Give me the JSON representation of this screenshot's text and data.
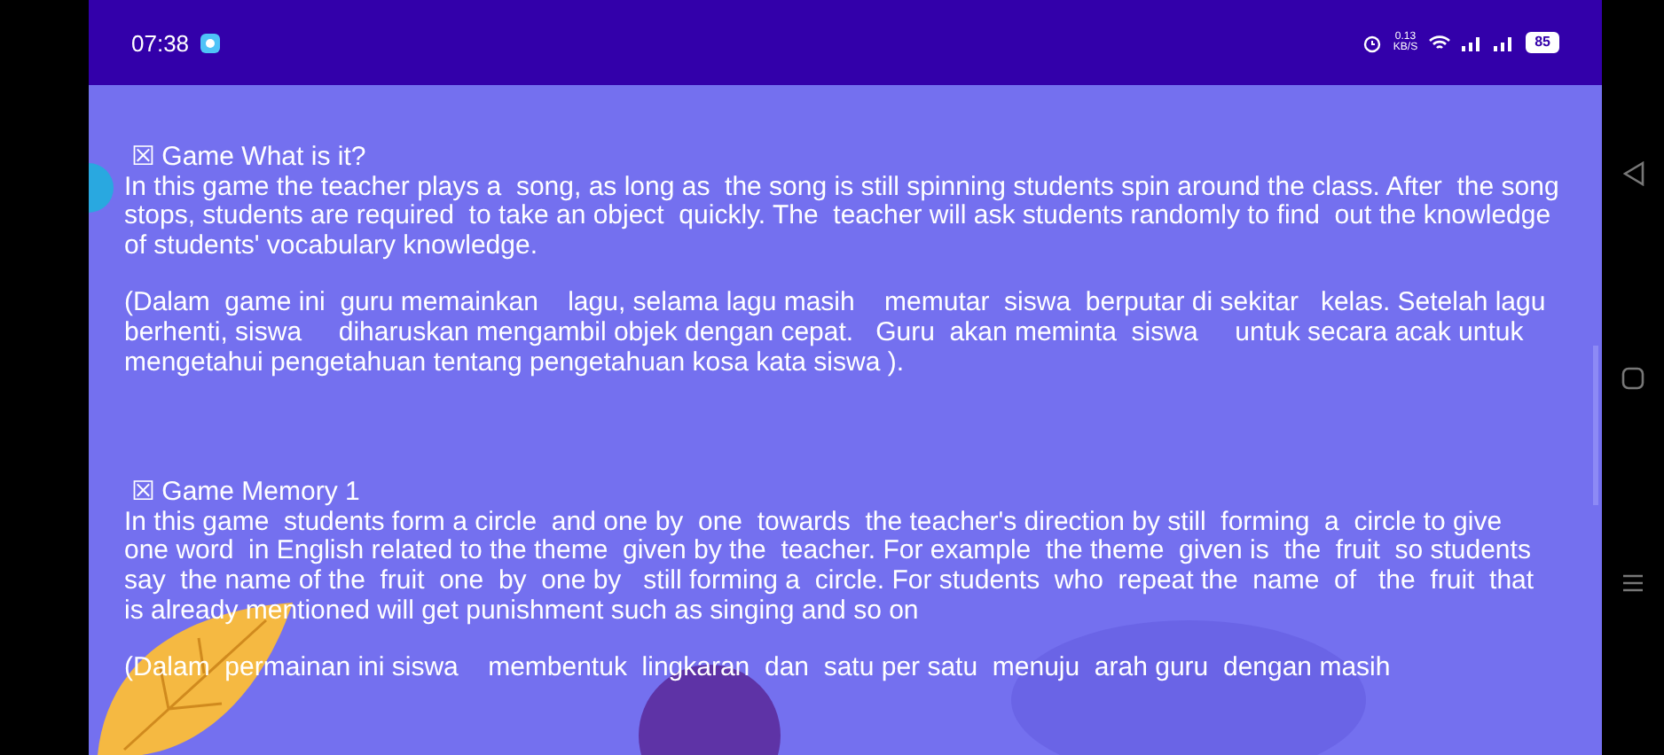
{
  "status_bar": {
    "time": "07:38",
    "speed_value": "0.13",
    "speed_unit": "KB/S",
    "battery": "85"
  },
  "sections": [
    {
      "heading": "☒ Game What is it?",
      "english": "In this game the teacher plays a  song, as long as  the song is still spinning students spin around the class. After  the song stops, students are required  to take an object  quickly. The  teacher will ask students randomly to find  out the knowledge of students' vocabulary knowledge.",
      "indonesian": "(Dalam  game ini  guru memainkan    lagu, selama lagu masih    memutar  siswa  berputar di sekitar   kelas. Setelah lagu berhenti, siswa     diharuskan mengambil objek dengan cepat.   Guru  akan meminta  siswa     untuk secara acak untuk mengetahui pengetahuan tentang pengetahuan kosa kata siswa )."
    },
    {
      "heading": "☒ Game Memory 1",
      "english": "In this game  students form a circle  and one by  one  towards  the teacher's direction by still  forming  a  circle to give  one word  in English related to the theme  given by the  teacher. For example  the theme  given is  the  fruit  so students  say  the name of the  fruit  one  by  one by   still forming a  circle. For students  who  repeat the  name  of   the  fruit  that is already mentioned will get punishment such as singing and so on",
      "indonesian": "(Dalam  permainan ini siswa    membentuk  lingkaran  dan  satu per satu  menuju  arah guru  dengan masih"
    }
  ]
}
